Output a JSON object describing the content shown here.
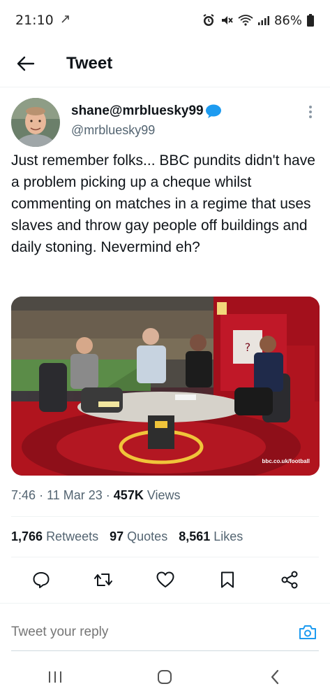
{
  "status_bar": {
    "time": "21:10",
    "battery": "86%"
  },
  "header": {
    "title": "Tweet"
  },
  "tweet": {
    "display_name": "shane@mrbluesky99",
    "handle": "@mrbluesky99",
    "text": "Just remember folks... BBC pundits didn't have a problem picking up a cheque whilst commenting on matches in a regime that uses slaves and throw gay people off buildings and daily stoning. Nevermind eh?",
    "media_watermark": "bbc.co.uk/football",
    "time": "7:46",
    "date": "11 Mar 23",
    "views_count": "457K",
    "views_label": "Views"
  },
  "stats": {
    "retweets_count": "1,766",
    "retweets_label": "Retweets",
    "quotes_count": "97",
    "quotes_label": "Quotes",
    "likes_count": "8,561",
    "likes_label": "Likes"
  },
  "reply": {
    "placeholder": "Tweet your reply"
  },
  "colors": {
    "accent": "#1d9bf0",
    "text_secondary": "#536471"
  }
}
